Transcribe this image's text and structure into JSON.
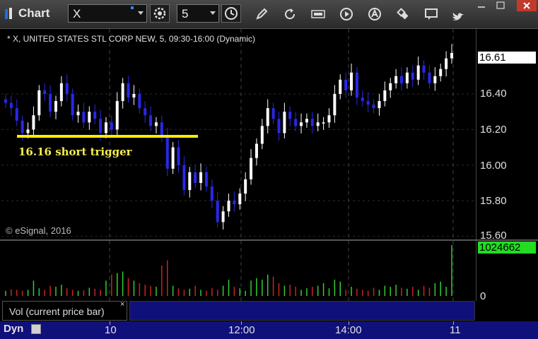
{
  "toolbar": {
    "title": "Chart",
    "symbol_value": "X",
    "interval_value": "5"
  },
  "chart": {
    "legend": "* X, UNITED STATES STL CORP NEW, 5, 09:30-16:00 (Dynamic)",
    "copyright": "© eSignal, 2016",
    "annotation": "16.16 short trigger",
    "trigger_price": 16.16,
    "last_price_label": "16.61",
    "last_price": 16.61,
    "price_axis": [
      "16.40",
      "16.20",
      "16.00",
      "15.80",
      "15.60"
    ],
    "volume_axis_zero": "0",
    "last_volume_label": "1024662",
    "time_axis": [
      "10",
      "12:00",
      "14:00",
      "11"
    ],
    "study_label": "Vol (current price bar)",
    "study_close": "×",
    "mode_label": "Dyn",
    "colors": {
      "up": "#ffffff",
      "down": "#2828e8",
      "vol_up": "#33cc33",
      "vol_down": "#cc2222",
      "trigger_line": "#ffee00",
      "last_volume_box": "#22dd22"
    }
  },
  "chart_data": {
    "type": "candlestick",
    "title": "* X, UNITED STATES STL CORP NEW, 5, 09:30-16:00 (Dynamic)",
    "ylim": [
      15.6,
      16.7
    ],
    "x_ticks": [
      "10",
      "12:00",
      "14:00",
      "11"
    ],
    "y_ticks": [
      16.4,
      16.2,
      16.0,
      15.8,
      15.6
    ],
    "price_series": [
      16.35,
      16.32,
      16.25,
      16.18,
      16.2,
      16.28,
      16.42,
      16.4,
      16.3,
      16.36,
      16.46,
      16.4,
      16.28,
      16.3,
      16.24,
      16.3,
      16.26,
      16.18,
      16.24,
      16.2,
      16.36,
      16.46,
      16.38,
      16.4,
      16.32,
      16.28,
      16.22,
      16.24,
      16.16,
      15.98,
      16.1,
      16.0,
      15.86,
      15.96,
      15.9,
      15.96,
      15.88,
      15.8,
      15.68,
      15.74,
      15.8,
      15.78,
      15.84,
      15.92,
      16.04,
      16.12,
      16.22,
      16.32,
      16.26,
      16.18,
      16.3,
      16.26,
      16.22,
      16.24,
      16.26,
      16.22,
      16.24,
      16.24,
      16.28,
      16.4,
      16.48,
      16.42,
      16.52,
      16.38,
      16.36,
      16.34,
      16.32,
      16.36,
      16.42,
      16.46,
      16.5,
      16.46,
      16.52,
      16.48,
      16.56,
      16.52,
      16.46,
      16.5,
      16.54,
      16.6,
      16.63
    ],
    "volume_series": [
      0.1,
      0.13,
      0.12,
      0.1,
      0.12,
      0.3,
      0.15,
      0.12,
      0.2,
      0.18,
      0.22,
      0.15,
      0.12,
      0.1,
      0.11,
      0.16,
      0.14,
      0.12,
      0.3,
      0.42,
      0.45,
      0.48,
      0.35,
      0.3,
      0.25,
      0.22,
      0.2,
      0.18,
      0.6,
      0.7,
      0.2,
      0.15,
      0.12,
      0.14,
      0.2,
      0.12,
      0.1,
      0.15,
      0.12,
      0.2,
      0.32,
      0.18,
      0.15,
      0.1,
      0.3,
      0.35,
      0.32,
      0.42,
      0.38,
      0.25,
      0.2,
      0.22,
      0.18,
      0.12,
      0.15,
      0.18,
      0.2,
      0.25,
      0.15,
      0.32,
      0.28,
      0.12,
      0.18,
      0.14,
      0.12,
      0.1,
      0.16,
      0.12,
      0.2,
      0.18,
      0.22,
      0.16,
      0.14,
      0.18,
      0.12,
      0.2,
      0.16,
      0.25,
      0.28,
      0.18,
      1.0
    ],
    "last_volume": 1024662
  }
}
